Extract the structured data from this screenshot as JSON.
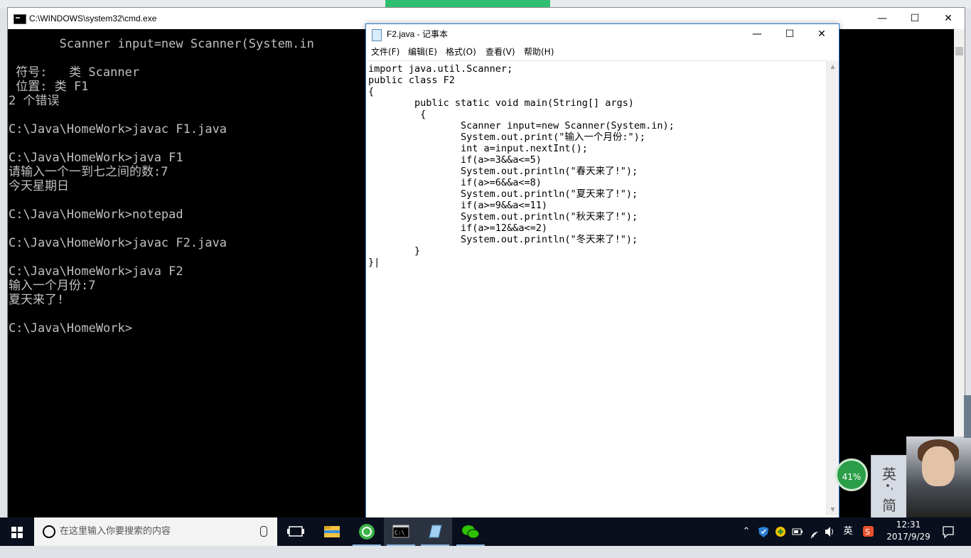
{
  "cmd": {
    "title": "C:\\WINDOWS\\system32\\cmd.exe",
    "lines": [
      "       Scanner input=new Scanner(System.in",
      "",
      " 符号:   类 Scanner",
      " 位置: 类 F1",
      "2 个错误",
      "",
      "C:\\Java\\HomeWork>javac F1.java",
      "",
      "C:\\Java\\HomeWork>java F1",
      "请输入一个一到七之间的数:7",
      "今天星期日",
      "",
      "C:\\Java\\HomeWork>notepad",
      "",
      "C:\\Java\\HomeWork>javac F2.java",
      "",
      "C:\\Java\\HomeWork>java F2",
      "输入一个月份:7",
      "夏天来了!",
      "",
      "C:\\Java\\HomeWork>"
    ]
  },
  "window_controls": {
    "minimize": "—",
    "maximize": "☐",
    "close": "✕"
  },
  "notepad": {
    "title": "F2.java - 记事本",
    "menu": [
      "文件(F)",
      "编辑(E)",
      "格式(O)",
      "查看(V)",
      "帮助(H)"
    ],
    "code": [
      "import java.util.Scanner;",
      "public class F2",
      "{",
      "        public static void main(String[] args)",
      "         {",
      "                Scanner input=new Scanner(System.in);",
      "                System.out.print(\"输入一个月份:\");",
      "                int a=input.nextInt();",
      "                if(a>=3&&a<=5)",
      "                System.out.println(\"春天来了!\");",
      "                if(a>=6&&a<=8)",
      "                System.out.println(\"夏天来了!\");",
      "                if(a>=9&&a<=11)",
      "                System.out.println(\"秋天来了!\");",
      "                if(a>=12&&a<=2)",
      "                System.out.println(\"冬天来了!\");",
      "        }",
      "}|"
    ]
  },
  "taskbar": {
    "search_placeholder": "在这里输入你要搜索的内容",
    "apps": [
      "task-view-icon",
      "file-explorer-icon",
      "browser-360-icon",
      "cmd-icon",
      "notepad-icon",
      "wechat-icon"
    ],
    "tray": {
      "ime_lang": "英",
      "time": "12:31",
      "date": "2017/9/29"
    }
  },
  "widgets": {
    "memory_percent": "41%",
    "ime_top": "英",
    "ime_dots": "•,",
    "ime_bottom": "简"
  }
}
